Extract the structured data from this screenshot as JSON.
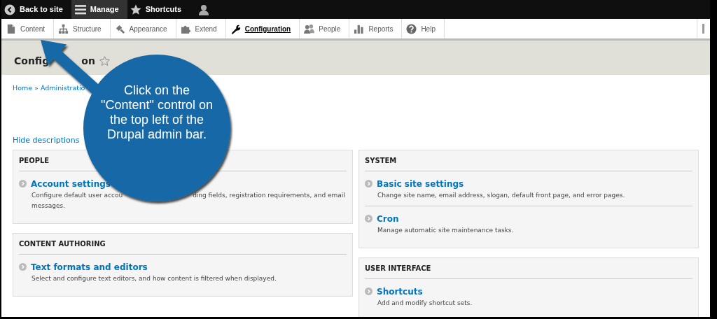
{
  "toolbar": {
    "items": [
      {
        "label": "Back to site",
        "kind": "back",
        "selected": false
      },
      {
        "label": "Manage",
        "kind": "menu",
        "selected": true
      },
      {
        "label": "Shortcuts",
        "kind": "star",
        "selected": false
      },
      {
        "kind": "user",
        "selected": false
      }
    ]
  },
  "tray": {
    "items": [
      {
        "label": "Content",
        "kind": "doc",
        "selected": false
      },
      {
        "label": "Structure",
        "kind": "structure",
        "selected": false
      },
      {
        "label": "Appearance",
        "kind": "brush",
        "selected": false
      },
      {
        "label": "Extend",
        "kind": "puzzle",
        "selected": false
      },
      {
        "label": "Configuration",
        "kind": "wrench",
        "selected": true
      },
      {
        "label": "People",
        "kind": "people",
        "selected": false
      },
      {
        "label": "Reports",
        "kind": "bars",
        "selected": false
      },
      {
        "label": "Help",
        "kind": "help",
        "selected": false
      }
    ]
  },
  "page": {
    "title_parts": [
      "Config",
      "on"
    ],
    "breadcrumb": "Home » Administratio",
    "hide_descriptions": "Hide descriptions"
  },
  "columns": [
    [
      {
        "title": "PEOPLE",
        "items": [
          {
            "title": "Account settings",
            "description_lines": [
              [
                "Configure default user accou",
                "ding fields, registration requirements, and email"
              ],
              [
                "messages."
              ]
            ]
          }
        ]
      },
      {
        "title": "CONTENT AUTHORING",
        "items": [
          {
            "title": "Text formats and editors",
            "description_lines": [
              [
                "Select and configure text editors, and how content is filtered when displayed."
              ]
            ]
          }
        ]
      }
    ],
    [
      {
        "title": "SYSTEM",
        "items": [
          {
            "title": "Basic site settings",
            "description_lines": [
              [
                "Change site name, email address, slogan, default front page, and error pages."
              ]
            ]
          },
          {
            "title": "Cron",
            "description_lines": [
              [
                "Manage automatic site maintenance tasks."
              ]
            ]
          }
        ]
      },
      {
        "title": "USER INTERFACE",
        "items": [
          {
            "title": "Shortcuts",
            "description_lines": [
              [
                "Add and modify shortcut sets."
              ]
            ]
          }
        ]
      }
    ]
  ],
  "callout": {
    "lines": [
      "Click on the",
      "\"Content\" control on",
      "the top left of the",
      "Drupal admin bar."
    ]
  }
}
